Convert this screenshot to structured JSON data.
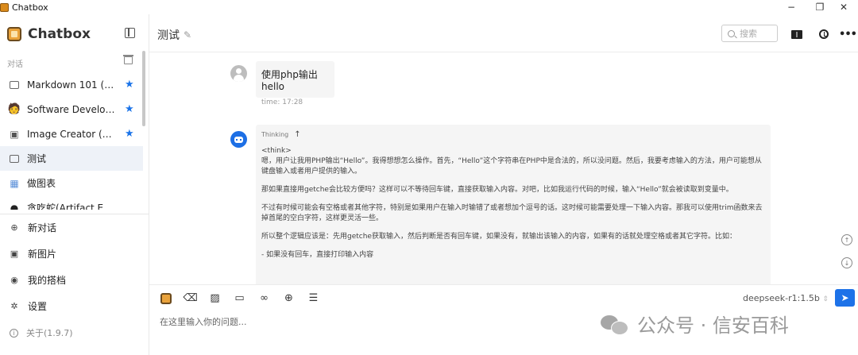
{
  "window": {
    "app_name": "Chatbox",
    "controls": {
      "minimize": "−",
      "restore": "❐",
      "close": "✕"
    }
  },
  "sidebar": {
    "brand": "Chatbox",
    "section_label": "对话",
    "conversations": [
      {
        "label": "Markdown 101 (Exa...",
        "icon": "chat-bubble-icon",
        "starred": true,
        "active": false
      },
      {
        "label": "Software Developer ...",
        "icon": "developer-avatar-icon",
        "starred": true,
        "active": false
      },
      {
        "label": "Image Creator (Exa...",
        "icon": "image-icon",
        "starred": true,
        "active": false
      },
      {
        "label": "测试",
        "icon": "chat-bubble-icon",
        "starred": false,
        "active": true
      },
      {
        "label": "做图表",
        "icon": "chart-avatar-icon",
        "starred": false,
        "active": false
      },
      {
        "label": "贪吃蛇(Artifact Example)",
        "icon": "snake-avatar-icon",
        "starred": false,
        "active": false
      }
    ],
    "menu": [
      {
        "label": "新对话",
        "icon": "plus-circle-icon"
      },
      {
        "label": "新图片",
        "icon": "image-icon"
      },
      {
        "label": "我的搭档",
        "icon": "robot-icon"
      },
      {
        "label": "设置",
        "icon": "gear-icon"
      }
    ],
    "about": "关于(1.9.7)"
  },
  "header": {
    "title": "测试",
    "search_placeholder": "搜索"
  },
  "messages": {
    "user": {
      "text": "使用php输出hello",
      "time": "time: 17:28"
    },
    "assistant": {
      "thinking_label": "Thinking",
      "lines": [
        "<think>",
        "嗯，用户让我用PHP输出“Hello”。我得想想怎么操作。首先，“Hello”这个字符串在PHP中是合法的，所以没问题。然后，我要考虑输入的方法，用户可能想从键盘输入或者用户提供的输入。",
        "那如果直接用getche会比较方便吗？这样可以不等待回车键，直接获取输入内容。对吧，比如我运行代码的时候，输入“Hello”就会被读取到变量中。",
        "不过有时候可能会有空格或者其他字符，特别是如果用户在输入时输错了或者想加个逗号的话。这时候可能需要处理一下输入内容。那我可以使用trim函数来去掉首尾的空白字符，这样更灵活一些。",
        "所以整个逻辑应该是：先用getche获取输入，然后判断是否有回车键，如果没有，就输出该输入的内容，如果有的话就处理空格或者其它字符。比如：",
        "- 如果没有回车，直接打印输入内容"
      ]
    }
  },
  "input": {
    "placeholder": "在这里输入你的问题...",
    "model": "deepseek-r1:1.5b"
  },
  "watermark": "公众号 · 信安百科"
}
